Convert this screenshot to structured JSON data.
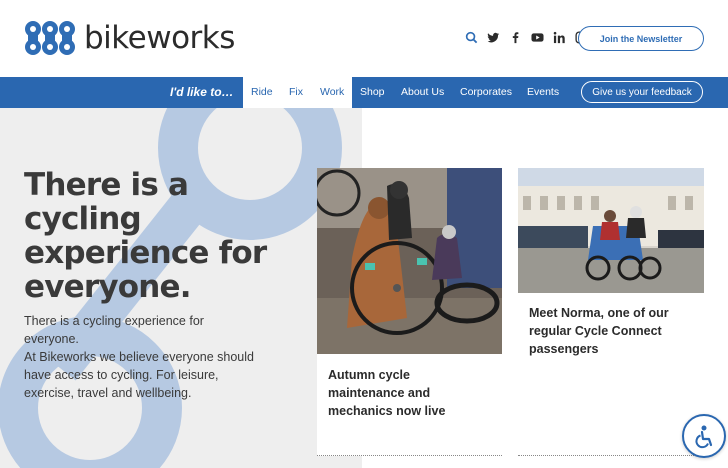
{
  "brand": {
    "name": "bikeworks",
    "primary_color": "#2a67b0",
    "logo_color": "#2f6db5"
  },
  "header": {
    "social_icons": [
      "search-icon",
      "twitter-icon",
      "facebook-icon",
      "youtube-icon",
      "linkedin-icon",
      "instagram-icon"
    ],
    "newsletter_label": "Join the Newsletter"
  },
  "nav": {
    "prompt": "I'd like to…",
    "items": [
      {
        "label": "Ride"
      },
      {
        "label": "Fix"
      },
      {
        "label": "Work"
      },
      {
        "label": "Shop"
      },
      {
        "label": "About Us"
      },
      {
        "label": "Corporates"
      },
      {
        "label": "Events"
      }
    ],
    "feedback_label": "Give us your feedback"
  },
  "hero": {
    "title": "There is a cycling experience for everyone.",
    "paragraph1": "There is a cycling experience for everyone.",
    "paragraph2": "At Bikeworks we believe everyone should have access to cycling. For leisure, exercise, travel and wellbeing."
  },
  "cards": [
    {
      "title": "Autumn cycle maintenance and mechanics now live"
    },
    {
      "title": "Meet Norma, one of our regular Cycle Connect passengers"
    }
  ]
}
